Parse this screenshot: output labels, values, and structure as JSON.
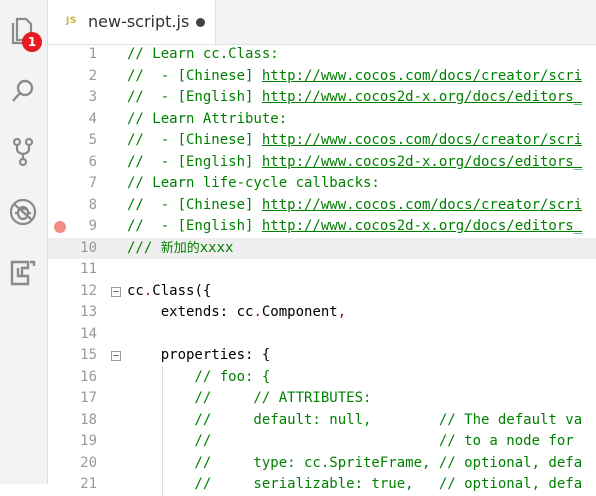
{
  "activity_bar": {
    "explorer_badge": "1",
    "items": [
      {
        "icon": "files-icon"
      },
      {
        "icon": "search-icon"
      },
      {
        "icon": "source-control-icon"
      },
      {
        "icon": "debug-icon"
      },
      {
        "icon": "extensions-icon"
      }
    ]
  },
  "tab": {
    "icon_text": "JS",
    "title": "new-script.js"
  },
  "editor": {
    "current_line": 10,
    "breakpoint_line": 9,
    "fold_lines": [
      12,
      15
    ],
    "lines": [
      {
        "n": "1",
        "segs": [
          {
            "t": "// Learn cc.Class:",
            "k": "c"
          }
        ]
      },
      {
        "n": "2",
        "segs": [
          {
            "t": "//  - [Chinese] ",
            "k": "c"
          },
          {
            "t": "http://www.cocos.com/docs/creator/scri",
            "k": "u"
          }
        ]
      },
      {
        "n": "3",
        "segs": [
          {
            "t": "//  - [English] ",
            "k": "c"
          },
          {
            "t": "http://www.cocos2d-x.org/docs/editors_",
            "k": "u"
          }
        ]
      },
      {
        "n": "4",
        "segs": [
          {
            "t": "// Learn Attribute:",
            "k": "c"
          }
        ]
      },
      {
        "n": "5",
        "segs": [
          {
            "t": "//  - [Chinese] ",
            "k": "c"
          },
          {
            "t": "http://www.cocos.com/docs/creator/scri",
            "k": "u"
          }
        ]
      },
      {
        "n": "6",
        "segs": [
          {
            "t": "//  - [English] ",
            "k": "c"
          },
          {
            "t": "http://www.cocos2d-x.org/docs/editors_",
            "k": "u"
          }
        ]
      },
      {
        "n": "7",
        "segs": [
          {
            "t": "// Learn life-cycle callbacks:",
            "k": "c"
          }
        ]
      },
      {
        "n": "8",
        "segs": [
          {
            "t": "//  - [Chinese] ",
            "k": "c"
          },
          {
            "t": "http://www.cocos.com/docs/creator/scri",
            "k": "u"
          }
        ]
      },
      {
        "n": "9",
        "segs": [
          {
            "t": "//  - [English] ",
            "k": "c"
          },
          {
            "t": "http://www.cocos2d-x.org/docs/editors_",
            "k": "u"
          }
        ]
      },
      {
        "n": "10",
        "segs": [
          {
            "t": "/// ",
            "k": "c"
          },
          {
            "t": "新加的",
            "k": "c cjk"
          },
          {
            "t": "xxxx",
            "k": "c"
          }
        ]
      },
      {
        "n": "11",
        "segs": []
      },
      {
        "n": "12",
        "segs": [
          {
            "t": "cc",
            "k": "p"
          },
          {
            "t": ".",
            "k": "pu"
          },
          {
            "t": "Class({",
            "k": "p"
          }
        ]
      },
      {
        "n": "13",
        "segs": [
          {
            "t": "    extends: cc",
            "k": "p"
          },
          {
            "t": ".",
            "k": "pu"
          },
          {
            "t": "Component",
            "k": "p"
          },
          {
            "t": ",",
            "k": "pu"
          }
        ]
      },
      {
        "n": "14",
        "segs": []
      },
      {
        "n": "15",
        "segs": [
          {
            "t": "    properties: {",
            "k": "p"
          }
        ]
      },
      {
        "n": "16",
        "segs": [
          {
            "t": "        // foo: {",
            "k": "c"
          }
        ]
      },
      {
        "n": "17",
        "segs": [
          {
            "t": "        //     // ATTRIBUTES:",
            "k": "c"
          }
        ]
      },
      {
        "n": "18",
        "segs": [
          {
            "t": "        //     default: null,        // The default va",
            "k": "c"
          }
        ]
      },
      {
        "n": "19",
        "segs": [
          {
            "t": "        //                           // to a node for",
            "k": "c"
          }
        ]
      },
      {
        "n": "20",
        "segs": [
          {
            "t": "        //     type: cc.SpriteFrame, // optional, defa",
            "k": "c"
          }
        ]
      },
      {
        "n": "21",
        "segs": [
          {
            "t": "        //     serializable: true,   // optional, defa",
            "k": "c"
          }
        ]
      }
    ]
  }
}
